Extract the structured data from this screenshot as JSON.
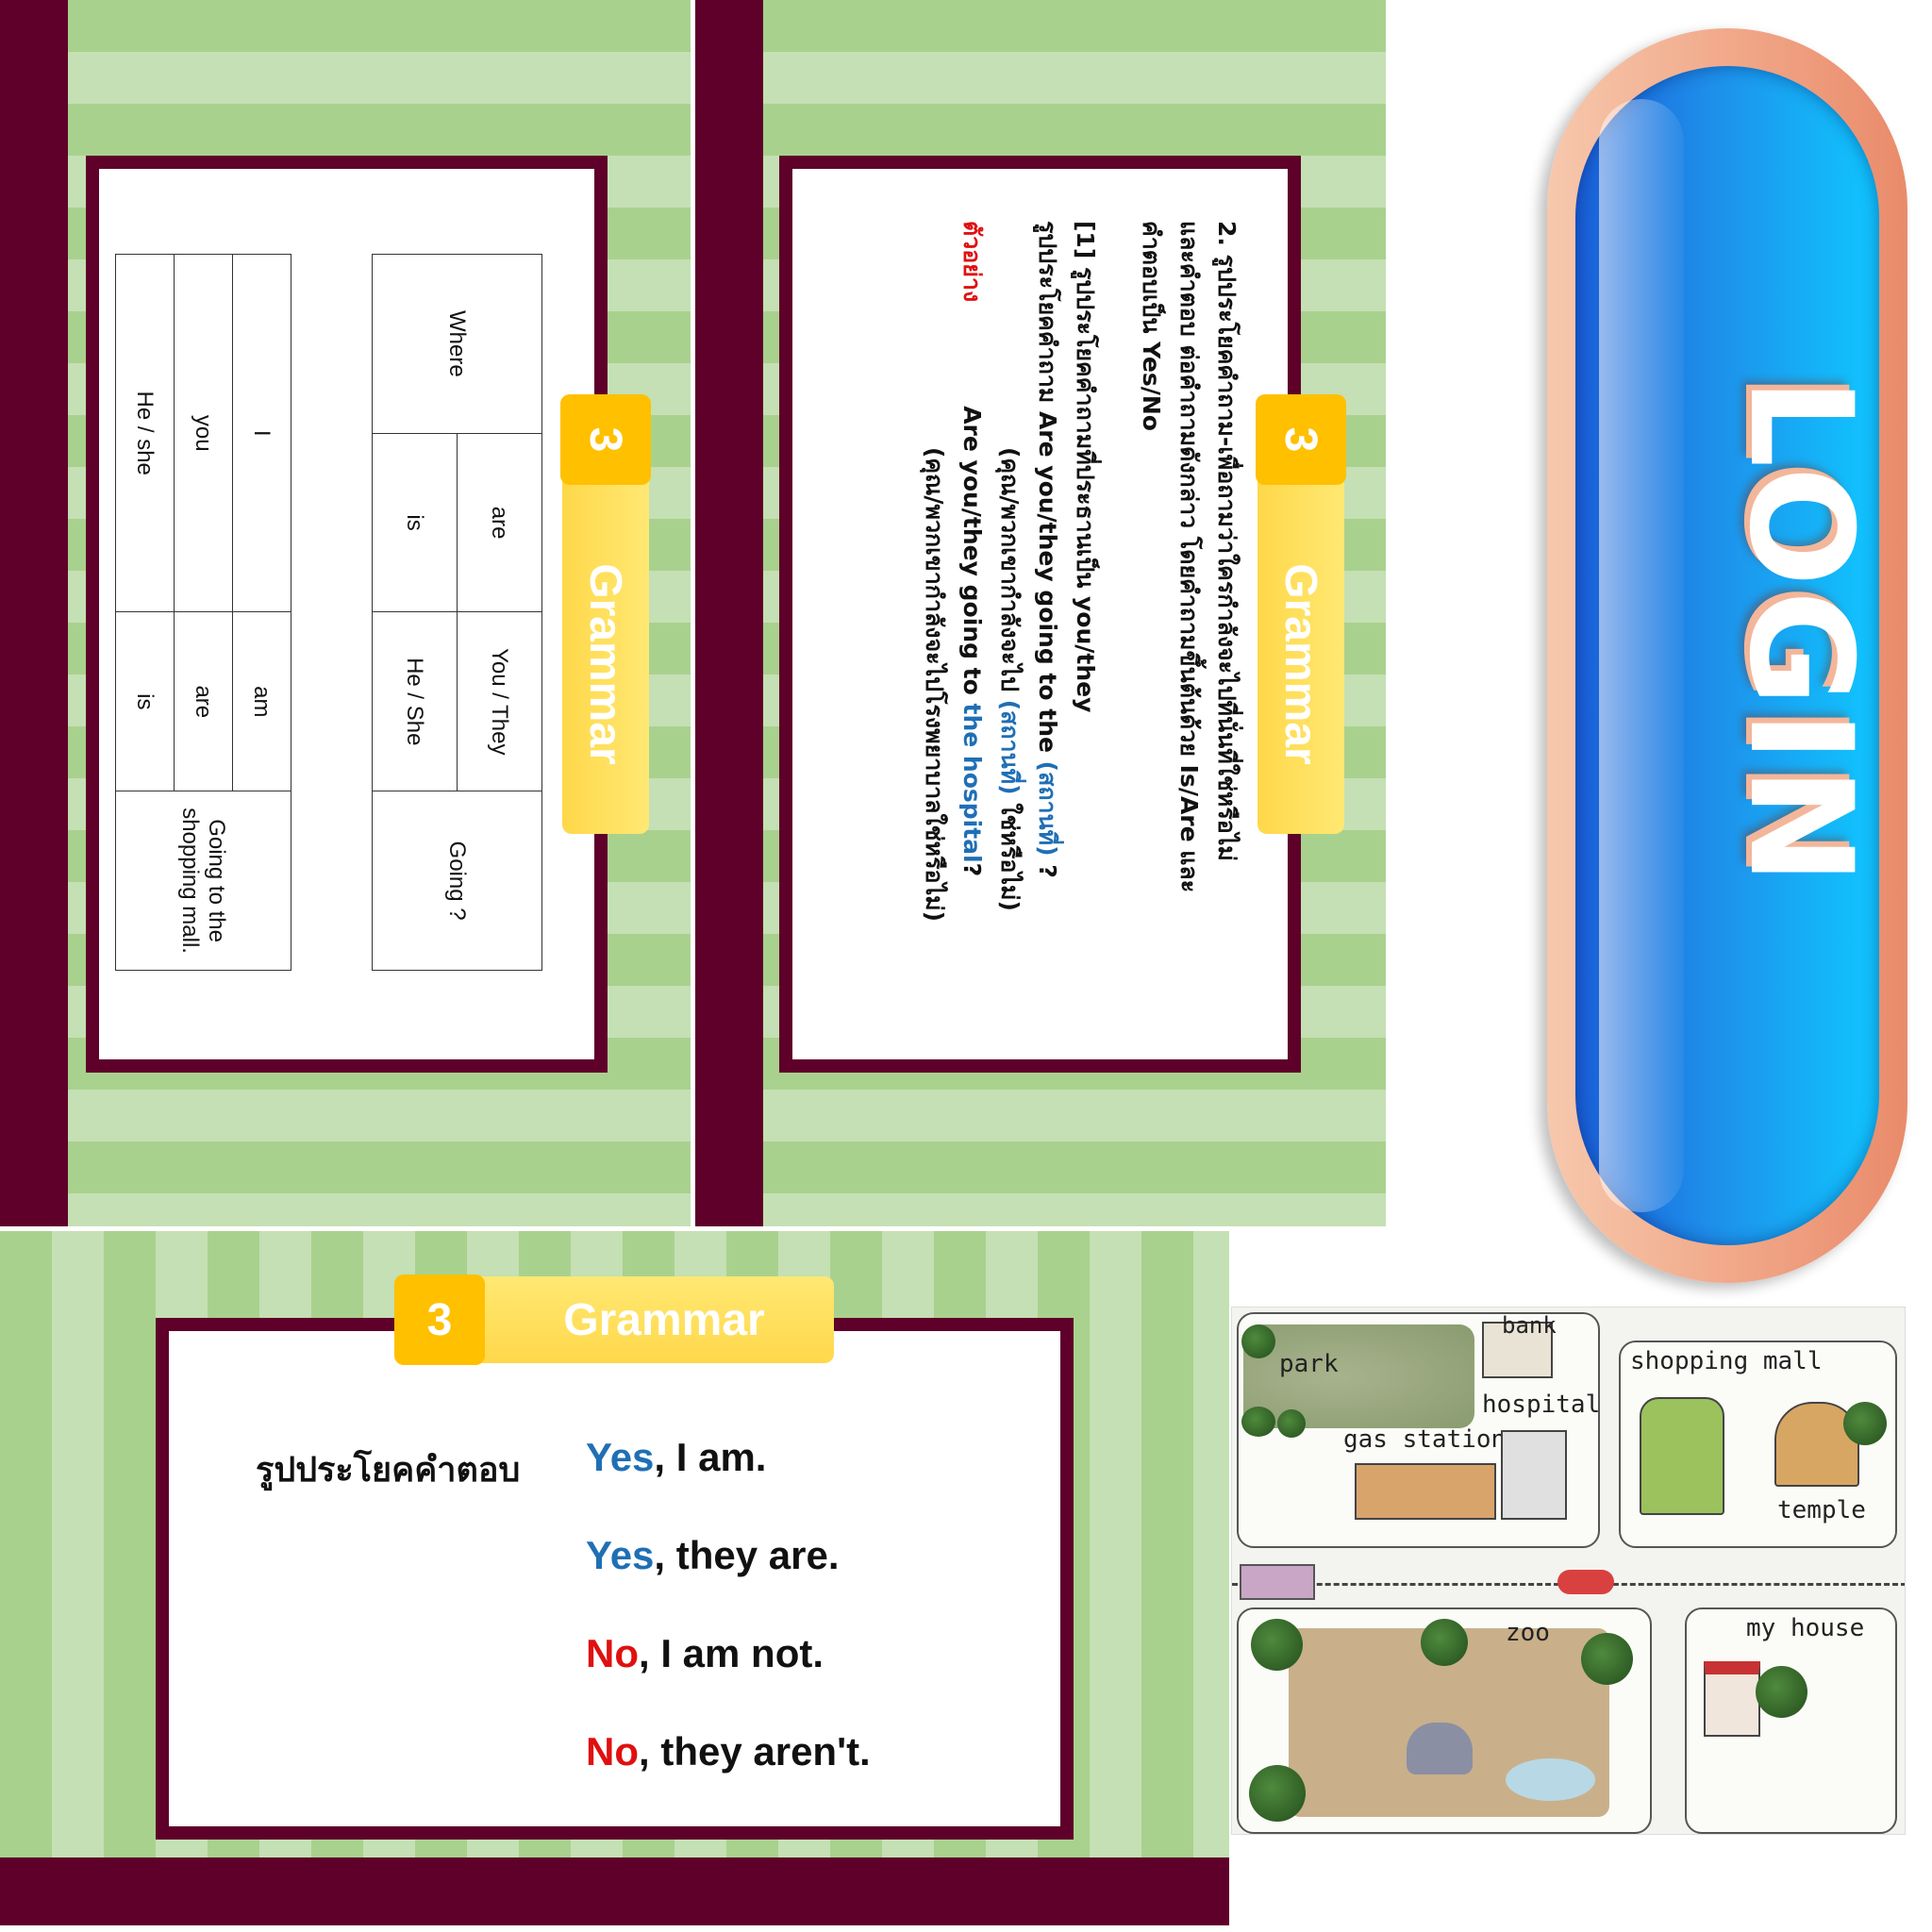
{
  "header": {
    "number": "3",
    "title": "Grammar"
  },
  "table_slide": {
    "rows": [
      [
        "Where",
        "are",
        "You / They",
        "Going ?"
      ],
      [
        "",
        "is",
        "He / She",
        ""
      ],
      [
        "I",
        "am",
        "Going to the shopping mall.",
        ""
      ],
      [
        "you",
        "are",
        "",
        ""
      ],
      [
        "He / she",
        "is",
        "",
        ""
      ]
    ]
  },
  "question_slide": {
    "line1": "2. รูปประโยคคำถาม-เพื่อถามว่าใครกำลังจะไปที่นั่นที่ใช่หรือไม่",
    "line2": "และคำตอบ ต่อคำถามดังกล่าว โดยคำถามขึ้นต้นด้วย Is/Are และ",
    "line3": "คำตอบเป็น Yes/No",
    "line4": "[1] รูปประโยคคำถามที่ประธานเป็น you/they",
    "line5_a": "รูปประโยคคำถาม    Are you/they going to the ",
    "line5_b": "(สถานที่)",
    "line5_c": " ?",
    "line6_a": "(คุณ/พวกเขากำลังจะไป ",
    "line6_b": "(สถานที่)",
    "line6_c": " ใช่หรือไม่)",
    "example_label": "ตัวอย่าง",
    "line7_a": "Are you/they going to ",
    "line7_b": "the hospital",
    "line7_c": "?",
    "line8": "(คุณ/พวกเขากำลังจะไปโรงพยาบาลใช่หรือไม่)"
  },
  "answer_slide": {
    "label": "รูปประโยคคำตอบ",
    "answers": [
      {
        "lead": "Yes",
        "rest": ", I am."
      },
      {
        "lead": "Yes",
        "rest": ", they are."
      },
      {
        "lead": "No",
        "rest": ", I am not."
      },
      {
        "lead": "No",
        "rest": ", they aren't."
      }
    ]
  },
  "login": {
    "label": "LOGIN"
  },
  "map": {
    "labels": {
      "park": "park",
      "bank": "bank",
      "hospital": "hospital",
      "gas_station": "gas station",
      "shopping_mall": "shopping mall",
      "temple": "temple",
      "zoo": "zoo",
      "my_house": "my house"
    }
  },
  "colors": {
    "maroon": "#5e0029",
    "stripe_dark": "#a9d18e",
    "stripe_light": "#c5e0b4",
    "badge_orange": "#ffc000",
    "badge_yellow": "#ffd84a",
    "accent_blue": "#1f6fb5",
    "accent_red": "#e01010"
  }
}
